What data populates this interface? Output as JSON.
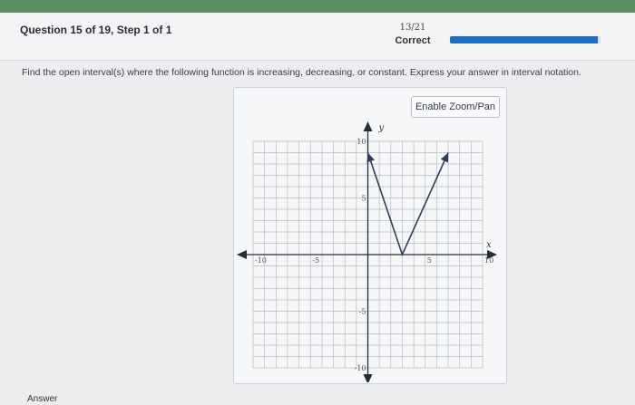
{
  "header": {
    "question_label": "Question 15 of 19, Step 1 of 1",
    "score_fraction": "13/21",
    "status": "Correct",
    "progress_fraction": 0.98
  },
  "prompt": "Find the open interval(s) where the following function is increasing, decreasing, or constant. Express your answer in interval notation.",
  "graph": {
    "zoom_button_label": "Enable Zoom/Pan",
    "x_axis_label": "x",
    "y_axis_label": "y",
    "x_ticks": [
      "-10",
      "-5",
      "5",
      "10"
    ],
    "y_ticks": [
      "10",
      "5",
      "-5",
      "-10"
    ],
    "x_range": [
      -10,
      10
    ],
    "y_range": [
      -10,
      10
    ],
    "grid": true,
    "curve_points": [
      [
        0,
        9
      ],
      [
        3,
        0
      ],
      [
        7,
        9
      ]
    ],
    "colors": {
      "curve": "#2f3e5a",
      "axis": "#2a2d33",
      "grid": "#b9bcc1"
    }
  },
  "footer": {
    "answer_label": "Answer"
  }
}
